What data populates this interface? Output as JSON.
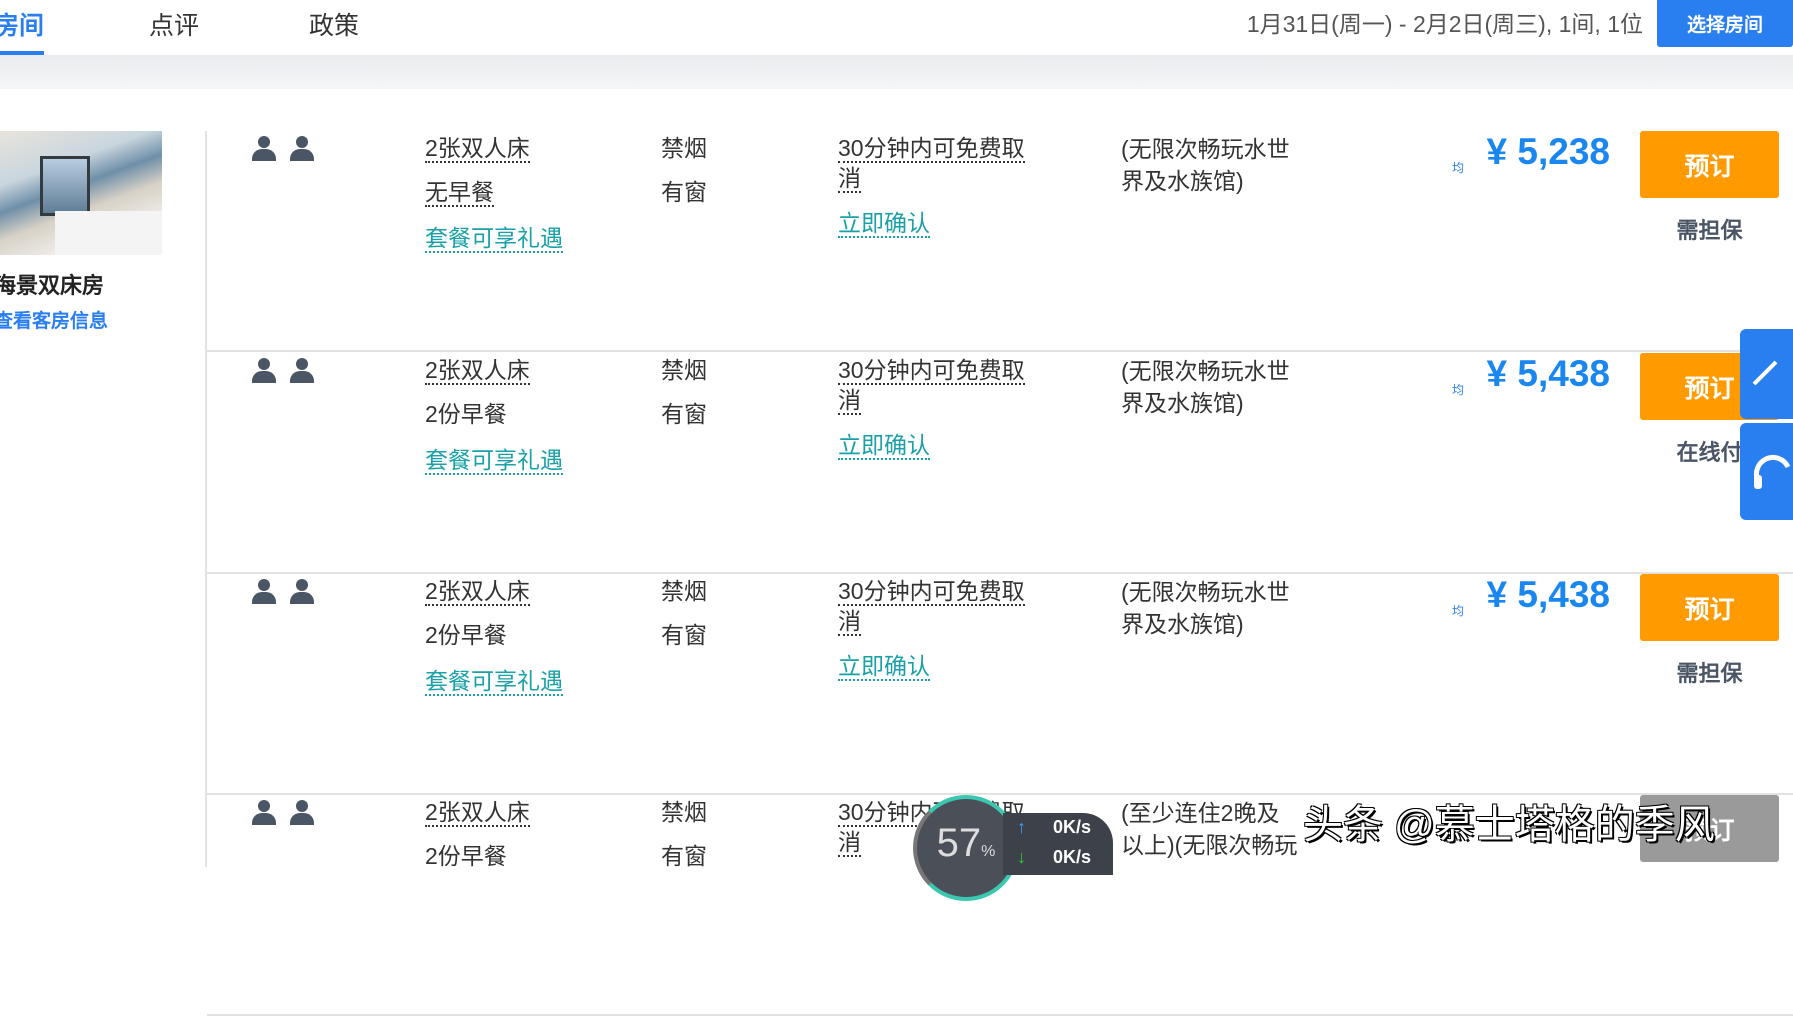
{
  "nav": {
    "tabs": [
      {
        "label": "房间",
        "active": true
      },
      {
        "label": "点评"
      },
      {
        "label": "政策"
      }
    ],
    "dates": "1月31日(周一) - 2月2日(周三), 1间, 1位",
    "select_button": "选择房间"
  },
  "room": {
    "title": "海景双床房",
    "link": "查看客房信息"
  },
  "rows": [
    {
      "bed": "2张双人床",
      "breakfast": "无早餐",
      "perk": "套餐可享礼遇",
      "smoke": "禁烟",
      "window": "有窗",
      "cancel1": "30分钟内可免费取",
      "cancel2": "消",
      "confirm": "立即确认",
      "note1": "(无限次畅玩水世",
      "note2": "界及水族馆)",
      "avg": "均",
      "price": "¥ 5,238",
      "book": "预订",
      "pay": "需担保"
    },
    {
      "bed": "2张双人床",
      "breakfast": "2份早餐",
      "perk": "套餐可享礼遇",
      "smoke": "禁烟",
      "window": "有窗",
      "cancel1": "30分钟内可免费取",
      "cancel2": "消",
      "confirm": "立即确认",
      "note1": "(无限次畅玩水世",
      "note2": "界及水族馆)",
      "avg": "均",
      "price": "¥ 5,438",
      "book": "预订",
      "pay": "在线付"
    },
    {
      "bed": "2张双人床",
      "breakfast": "2份早餐",
      "perk": "套餐可享礼遇",
      "smoke": "禁烟",
      "window": "有窗",
      "cancel1": "30分钟内可免费取",
      "cancel2": "消",
      "confirm": "立即确认",
      "note1": "(无限次畅玩水世",
      "note2": "界及水族馆)",
      "avg": "均",
      "price": "¥ 5,438",
      "book": "预订",
      "pay": "需担保"
    },
    {
      "bed": "2张双人床",
      "breakfast": "2份早餐",
      "smoke": "禁烟",
      "window": "有窗",
      "cancel1": "30分钟内可免费取",
      "cancel2": "消",
      "note1": "(至少连住2晚及",
      "note2": "以上)(无限次畅玩",
      "book": "预订"
    }
  ],
  "overlay": {
    "percent": "57",
    "percent_unit": "%",
    "up": "0K/s",
    "down": "0K/s",
    "watermark": "头条 @慕士塔格的季风"
  },
  "colors": {
    "accent": "#2a7ff0",
    "book": "#ff9a00",
    "price": "#1a86f0",
    "link_teal": "#1aa1a8"
  }
}
